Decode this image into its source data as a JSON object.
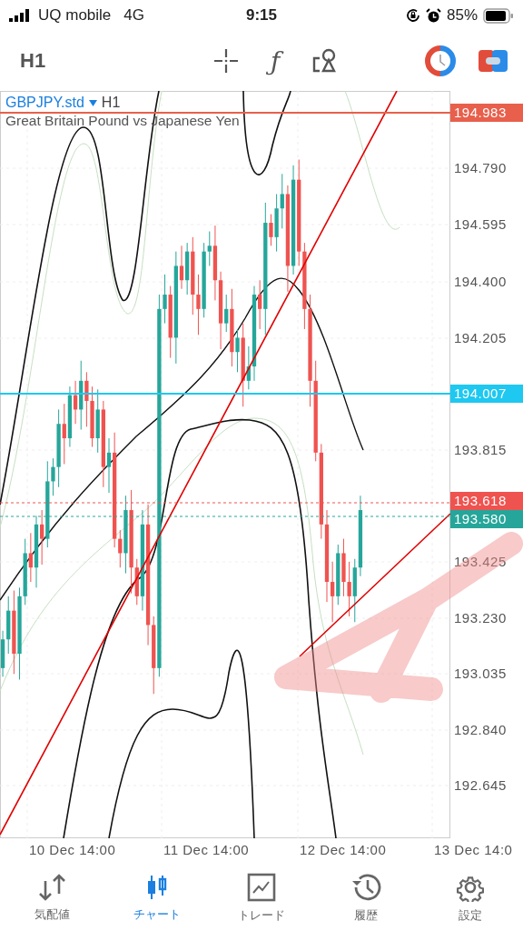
{
  "status_bar": {
    "carrier": "UQ mobile",
    "network": "4G",
    "time": "9:15",
    "battery": "85%"
  },
  "toolbar": {
    "timeframe": "H1",
    "indicator_glyph": "ƒ"
  },
  "chart": {
    "symbol": "GBPJPY.std",
    "timeframe": "H1",
    "description": "Great Britain Pound vs Japanese Yen",
    "price_ticks": [
      "194.790",
      "194.595",
      "194.400",
      "194.205",
      "193.815",
      "193.425",
      "193.230",
      "193.035",
      "192.840",
      "192.645"
    ],
    "price_lines": [
      {
        "label": "194.983",
        "color": "#e8604c",
        "kind": "solid"
      },
      {
        "label": "194.007",
        "color": "#1ec8f0",
        "kind": "solid"
      },
      {
        "label": "193.618",
        "color": "#ef5350",
        "kind": "dotted"
      },
      {
        "label": "193.580",
        "color": "#26a69a",
        "kind": "dotted"
      }
    ],
    "time_labels": [
      "10 Dec 14:00",
      "11 Dec 14:00",
      "12 Dec 14:00",
      "13 Dec 14:0"
    ]
  },
  "tabs": [
    {
      "label": "気配値",
      "selected": false
    },
    {
      "label": "チャート",
      "selected": true
    },
    {
      "label": "トレード",
      "selected": false
    },
    {
      "label": "履歴",
      "selected": false
    },
    {
      "label": "設定",
      "selected": false
    }
  ]
}
